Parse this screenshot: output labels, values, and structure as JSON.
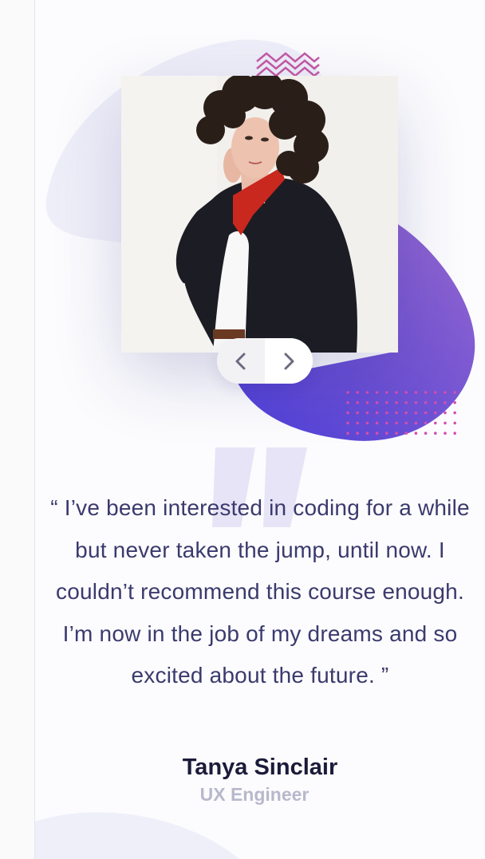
{
  "testimonial": {
    "quote": "“ I’ve been interested in coding for a while but never taken the jump, until now. I couldn’t recommend this course enough. I’m now in the job of my dreams and so excited about the future. ”",
    "name": "Tanya Sinclair",
    "role": "UX Engineer"
  },
  "icons": {
    "prev": "chevron-left-icon",
    "next": "chevron-right-icon",
    "quote": "quote-mark-icon",
    "zigzag": "zigzag-pattern",
    "dots": "dot-grid-pattern"
  },
  "colors": {
    "heading": "#1b1b3a",
    "body_text": "#3a3a6e",
    "muted": "#b8b8cc",
    "blob_start": "#4d3fd8",
    "blob_end": "#8f62cf",
    "accent_pink": "#c94a9e"
  }
}
